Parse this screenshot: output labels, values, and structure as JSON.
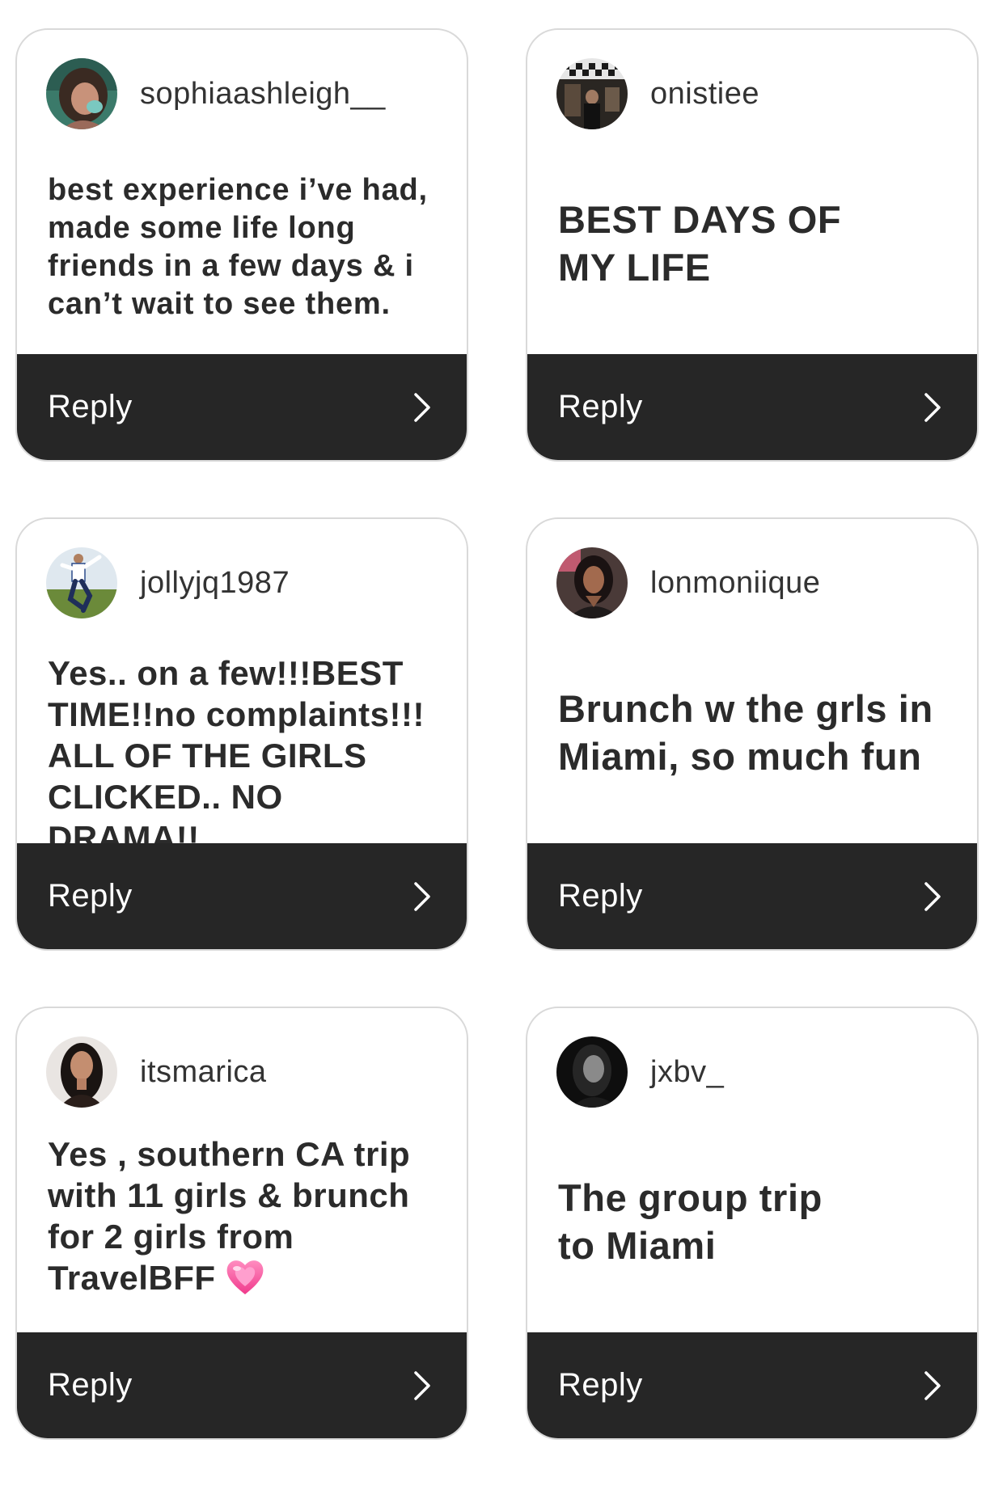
{
  "reply_label": "Reply",
  "cards": [
    {
      "username": "sophiaashleigh__",
      "message": "best experience i’ve had,\nmade some life long\nfriends in a few days & i\ncan’t wait to see them.",
      "avatar": "profile-photo-woman-icon"
    },
    {
      "username": "onistiee",
      "message": "BEST DAYS OF\nMY LIFE",
      "avatar": "profile-photo-room-icon"
    },
    {
      "username": "jollyjq1987",
      "message": "Yes.. on a few!!!BEST\nTIME!!no complaints!!!\nALL OF THE GIRLS\nCLICKED.. NO DRAMA!!",
      "avatar": "profile-photo-baseball-icon"
    },
    {
      "username": "lonmoniique",
      "message": "Brunch w the grls in\nMiami, so much fun",
      "avatar": "profile-photo-woman-icon"
    },
    {
      "username": "itsmarica",
      "message": "Yes , southern CA trip\nwith 11 girls & brunch\nfor 2 girls from\nTravelBFF",
      "emoji": "💓",
      "avatar": "profile-photo-woman-icon"
    },
    {
      "username": "jxbv_",
      "message": "The group trip\nto Miami",
      "avatar": "profile-photo-woman-bw-icon"
    }
  ],
  "colors": {
    "reply_bar": "#262626",
    "card_border": "#d9d9d9",
    "text": "#2b2b2b"
  }
}
